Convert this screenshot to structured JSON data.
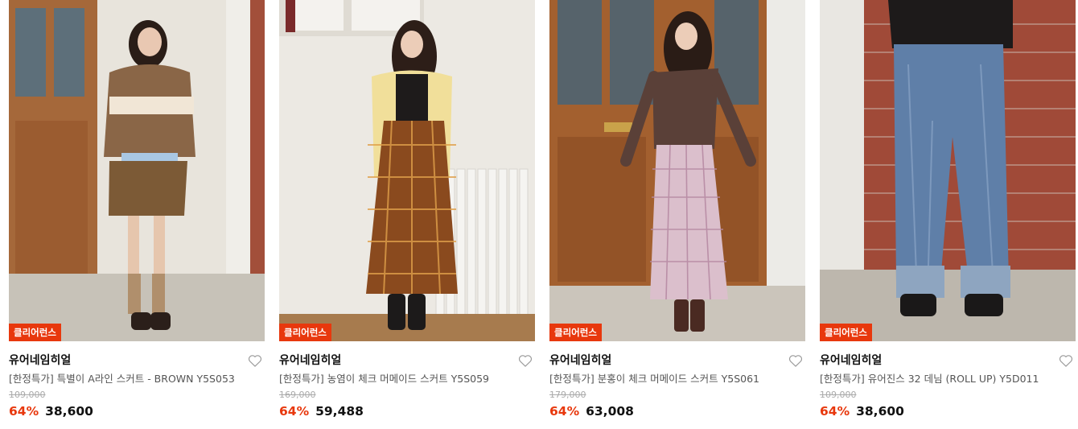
{
  "products": [
    {
      "badge": "클리어런스",
      "brand": "유어네임히얼",
      "name": "[한정특가] 특별이 A라인 스커트 - BROWN Y5S053",
      "original_price": "109,000",
      "discount": "64%",
      "price": "38,600",
      "image": "model-brown-heart-sweater-skirt"
    },
    {
      "badge": "클리어런스",
      "brand": "유어네임히얼",
      "name": "[한정특가] 농염이 체크 머메이드 스커트 Y5S059",
      "original_price": "169,000",
      "discount": "64%",
      "price": "59,488",
      "image": "model-yellow-cardigan-check-skirt"
    },
    {
      "badge": "클리어런스",
      "brand": "유어네임히얼",
      "name": "[한정특가] 분홍이 체크 머메이드 스커트 Y5S061",
      "original_price": "179,000",
      "discount": "64%",
      "price": "63,008",
      "image": "model-offshoulder-pink-check-skirt"
    },
    {
      "badge": "클리어런스",
      "brand": "유어네임히얼",
      "name": "[한정특가] 유어진스 32 데님 (ROLL UP) Y5D011",
      "original_price": "109,000",
      "discount": "64%",
      "price": "38,600",
      "image": "model-wide-denim-jeans"
    }
  ],
  "colors": {
    "accent": "#e8380d",
    "text": "#111111",
    "muted": "#555555"
  },
  "icons": {
    "wishlist": "heart-outline-icon"
  }
}
